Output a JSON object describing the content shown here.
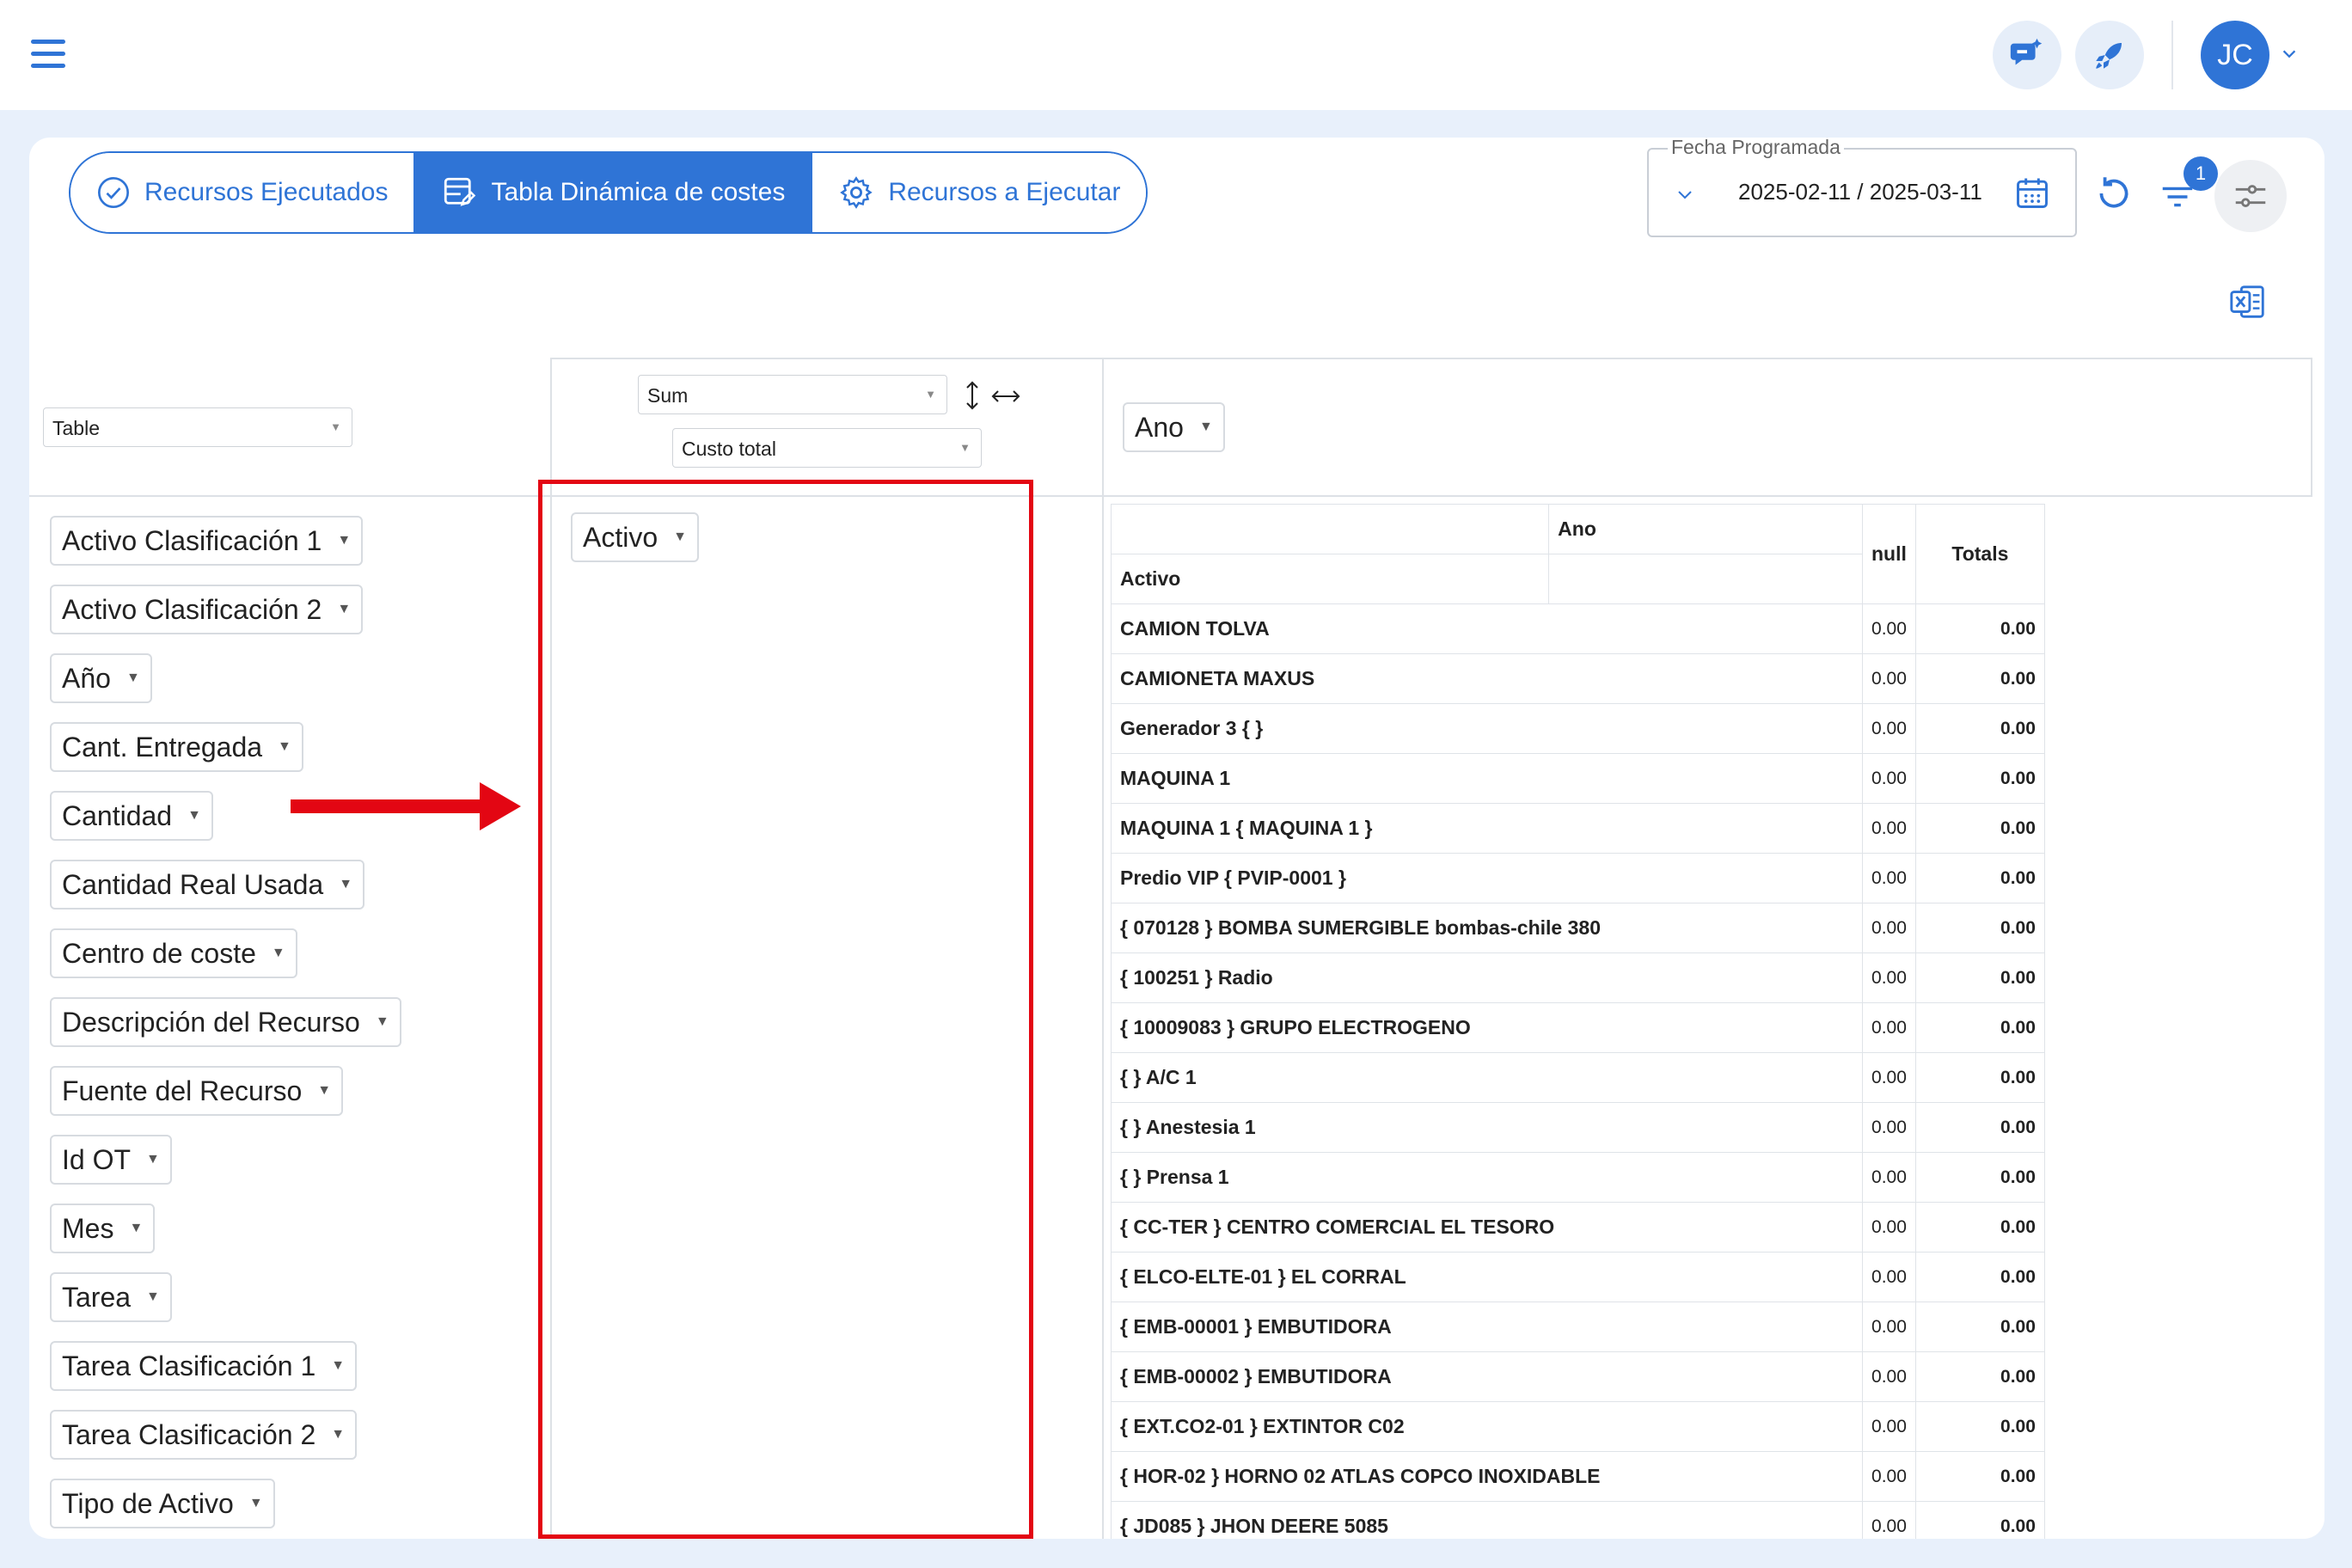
{
  "header": {
    "avatar_initials": "JC",
    "icons": [
      "menu-icon",
      "chat-sparkle-icon",
      "rocket-icon",
      "chevron-down-icon"
    ]
  },
  "tabs": [
    {
      "label": "Recursos Ejecutados",
      "icon": "check-circle-icon",
      "active": false
    },
    {
      "label": "Tabla Dinámica de costes",
      "icon": "table-edit-icon",
      "active": true
    },
    {
      "label": "Recursos a Ejecutar",
      "icon": "gear-icon",
      "active": false
    }
  ],
  "date_filter": {
    "legend": "Fecha Programada",
    "range": "2025-02-11 / 2025-03-11"
  },
  "filter_badge": "1",
  "pivot": {
    "renderer": "Table",
    "aggregator": "Sum",
    "value_field": "Custo total",
    "column_attr": "Ano",
    "row_attr": "Activo",
    "available_fields": [
      "Activo Clasificación 1",
      "Activo Clasificación 2",
      "Año",
      "Cant. Entregada",
      "Cantidad",
      "Cantidad Real Usada",
      "Centro de coste",
      "Descripción del Recurso",
      "Fuente del Recurso",
      "Id OT",
      "Mes",
      "Tarea",
      "Tarea Clasificación 1",
      "Tarea Clasificación 2",
      "Tipo de Activo"
    ]
  },
  "table": {
    "col_header": "Ano",
    "row_header": "Activo",
    "null_label": "null",
    "totals_label": "Totals",
    "rows": [
      {
        "label": "CAMION TOLVA",
        "value": "0.00",
        "total": "0.00"
      },
      {
        "label": "CAMIONETA MAXUS",
        "value": "0.00",
        "total": "0.00"
      },
      {
        "label": "Generador 3 { }",
        "value": "0.00",
        "total": "0.00"
      },
      {
        "label": "MAQUINA 1",
        "value": "0.00",
        "total": "0.00"
      },
      {
        "label": "MAQUINA 1 { MAQUINA 1 }",
        "value": "0.00",
        "total": "0.00"
      },
      {
        "label": "Predio VIP { PVIP-0001 }",
        "value": "0.00",
        "total": "0.00"
      },
      {
        "label": "{ 070128 } BOMBA SUMERGIBLE bombas-chile 380",
        "value": "0.00",
        "total": "0.00"
      },
      {
        "label": "{ 100251 } Radio",
        "value": "0.00",
        "total": "0.00"
      },
      {
        "label": "{ 10009083 } GRUPO ELECTROGENO",
        "value": "0.00",
        "total": "0.00"
      },
      {
        "label": "{ } A/C 1",
        "value": "0.00",
        "total": "0.00"
      },
      {
        "label": "{ } Anestesia 1",
        "value": "0.00",
        "total": "0.00"
      },
      {
        "label": "{ } Prensa 1",
        "value": "0.00",
        "total": "0.00"
      },
      {
        "label": "{ CC-TER } CENTRO COMERCIAL EL TESORO",
        "value": "0.00",
        "total": "0.00"
      },
      {
        "label": "{ ELCO-ELTE-01 } EL CORRAL",
        "value": "0.00",
        "total": "0.00"
      },
      {
        "label": "{ EMB-00001 } EMBUTIDORA",
        "value": "0.00",
        "total": "0.00"
      },
      {
        "label": "{ EMB-00002 } EMBUTIDORA",
        "value": "0.00",
        "total": "0.00"
      },
      {
        "label": "{ EXT.CO2-01 } EXTINTOR C02",
        "value": "0.00",
        "total": "0.00"
      },
      {
        "label": "{ HOR-02 } HORNO 02 ATLAS COPCO INOXIDABLE",
        "value": "0.00",
        "total": "0.00"
      },
      {
        "label": "{ JD085 } JHON DEERE 5085",
        "value": "0.00",
        "total": "0.00"
      }
    ]
  },
  "colors": {
    "primary": "#2f74d6",
    "highlight": "#e30613",
    "background": "#e8f0fb"
  }
}
